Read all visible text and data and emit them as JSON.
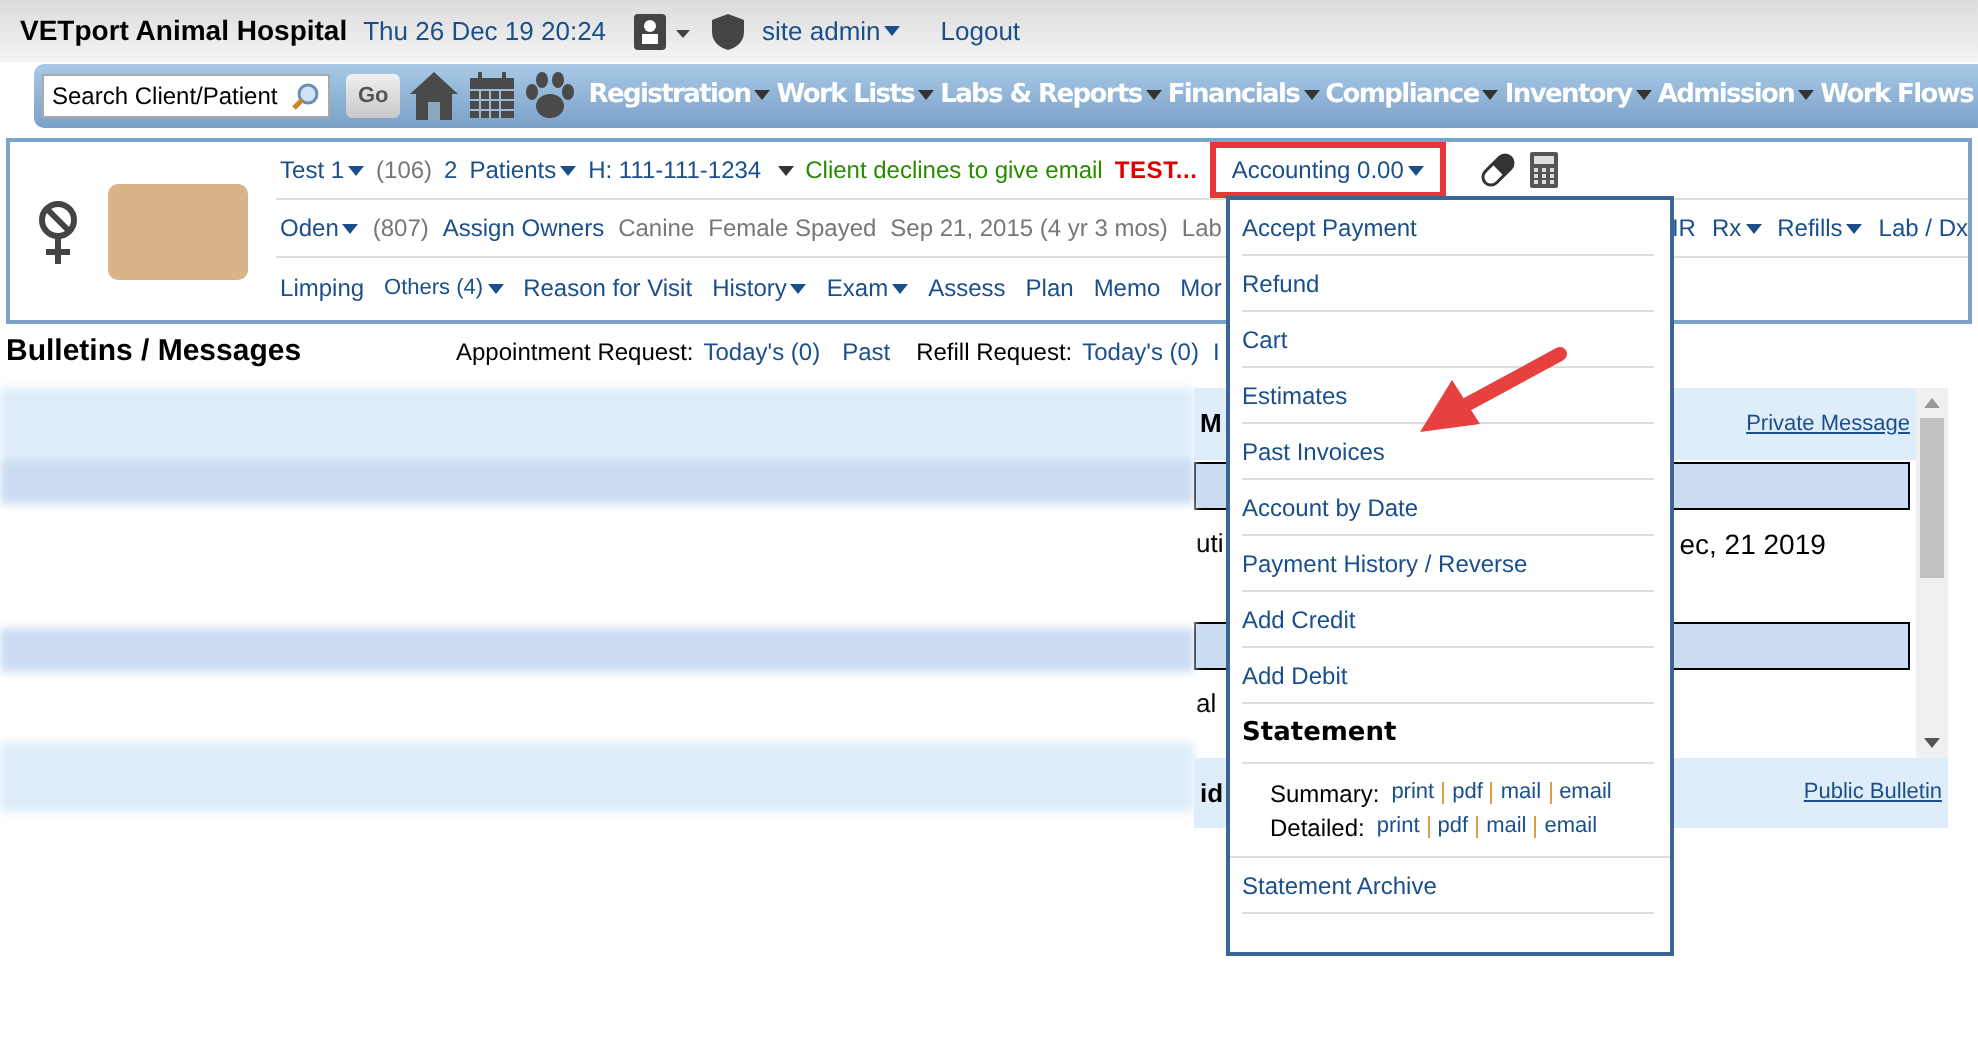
{
  "header": {
    "title": "VETport Animal Hospital",
    "datetime": "Thu 26 Dec 19 20:24",
    "user": "site admin",
    "logout": "Logout"
  },
  "navbar": {
    "search_placeholder": "Search Client/Patient",
    "go": "Go",
    "menus": [
      "Registration",
      "Work Lists",
      "Labs & Reports",
      "Financials",
      "Compliance",
      "Inventory",
      "Admission",
      "Work Flows"
    ]
  },
  "patient": {
    "row1": [
      {
        "text": "Test 1",
        "kind": "menu"
      },
      {
        "text": "(106)",
        "kind": "muted"
      },
      {
        "text": "2",
        "kind": "link"
      },
      {
        "text": "Patients",
        "kind": "menu"
      },
      {
        "text": "H: 111-111-1234",
        "kind": "link"
      },
      {
        "kind": "caret"
      },
      {
        "text": "Client declines to give email",
        "kind": "green"
      },
      {
        "text": "TEST...",
        "kind": "alert"
      }
    ],
    "accounting": {
      "label": "Accounting 0.00",
      "highlighted": true
    },
    "row2": [
      {
        "text": "Oden",
        "kind": "menu"
      },
      {
        "text": "(807)",
        "kind": "muted"
      },
      {
        "text": "Assign Owners",
        "kind": "link"
      },
      {
        "text": "Canine",
        "kind": "muted"
      },
      {
        "text": "Female Spayed",
        "kind": "muted"
      },
      {
        "text": "Sep 21, 2015 (4 yr 3 mos)",
        "kind": "muted"
      },
      {
        "text": "Lab",
        "kind": "muted"
      }
    ],
    "row2_right": [
      {
        "text": "IR",
        "kind": "link"
      },
      {
        "text": "Rx",
        "kind": "menu"
      },
      {
        "text": "Refills",
        "kind": "menu"
      },
      {
        "text": "Lab / Dx",
        "kind": "link"
      }
    ],
    "row3": [
      {
        "text": "Limping",
        "kind": "link"
      },
      {
        "text": "Others (4)",
        "kind": "small-menu"
      },
      {
        "text": "Reason for Visit",
        "kind": "link"
      },
      {
        "text": "History",
        "kind": "menu"
      },
      {
        "text": "Exam",
        "kind": "menu"
      },
      {
        "text": "Assess",
        "kind": "link"
      },
      {
        "text": "Plan",
        "kind": "link"
      },
      {
        "text": "Memo",
        "kind": "link"
      },
      {
        "text": "Mor",
        "kind": "link"
      }
    ]
  },
  "bulletins": {
    "title": "Bulletins / Messages",
    "appointment_label": "Appointment Request:",
    "appointment_today": "Today's (0)",
    "appointment_past": "Past",
    "refill_label": "Refill Request:",
    "refill_today": "Today's (0)",
    "refill_cut": "I"
  },
  "messages_panel": {
    "fragment_top": "M",
    "private_link": "Private Message",
    "fragment_mid": "uti",
    "date_text": "ec, 21 2019",
    "fragment_low": "al",
    "fragment_bottom": "id",
    "public_link": "Public Bulletin"
  },
  "accounting_menu": {
    "items": [
      {
        "label": "Accept Payment",
        "kind": "item"
      },
      {
        "label": "Refund",
        "kind": "item"
      },
      {
        "label": "Cart",
        "kind": "item"
      },
      {
        "label": "Estimates",
        "kind": "item"
      },
      {
        "label": "Past Invoices",
        "kind": "item"
      },
      {
        "label": "Account by Date",
        "kind": "item"
      },
      {
        "label": "Payment History / Reverse",
        "kind": "item"
      },
      {
        "label": "Add Credit",
        "kind": "item"
      },
      {
        "label": "Add Debit",
        "kind": "item"
      },
      {
        "label": "Statement",
        "kind": "heading"
      },
      {
        "kind": "links",
        "rows": [
          {
            "label": "Summary:",
            "links": [
              "print",
              "pdf",
              "mail",
              "email"
            ]
          },
          {
            "label": "Detailed:",
            "links": [
              "print",
              "pdf",
              "mail",
              "email"
            ]
          }
        ]
      },
      {
        "label": "Statement Archive",
        "kind": "item"
      }
    ]
  }
}
